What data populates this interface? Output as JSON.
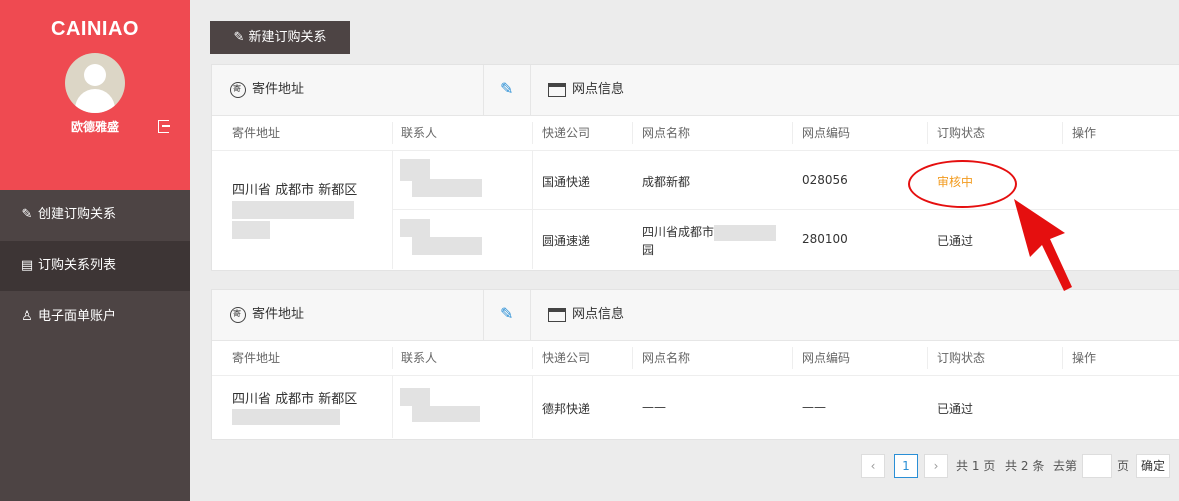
{
  "brand": {
    "logo": "CAINIAO",
    "username": "欧德雅盛"
  },
  "nav": [
    {
      "label": "创建订购关系",
      "icon": "edit-icon"
    },
    {
      "label": "订购关系列表",
      "icon": "list-icon"
    },
    {
      "label": "电子面单账户",
      "icon": "user-icon"
    }
  ],
  "toolbar": {
    "new_label": "新建订购关系"
  },
  "cards": [
    {
      "sender_title": "寄件地址",
      "branch_title": "网点信息",
      "headers": [
        "寄件地址",
        "联系人",
        "快递公司",
        "网点名称",
        "网点编码",
        "订购状态",
        "操作"
      ],
      "address": "四川省 成都市 新都区",
      "rows": [
        {
          "company": "国通快递",
          "branch_name": "成都新都",
          "branch_name_2": "",
          "code": "028056",
          "status": "审核中"
        },
        {
          "company": "圆通速递",
          "branch_name": "四川省成都市",
          "branch_name_2": "园",
          "code": "280100",
          "status": "已通过"
        }
      ]
    },
    {
      "sender_title": "寄件地址",
      "branch_title": "网点信息",
      "headers": [
        "寄件地址",
        "联系人",
        "快递公司",
        "网点名称",
        "网点编码",
        "订购状态",
        "操作"
      ],
      "address": "四川省 成都市 新都区",
      "rows": [
        {
          "company": "德邦快递",
          "branch_name": "——",
          "code": "——",
          "status": "已通过"
        }
      ]
    }
  ],
  "pagination": {
    "current": "1",
    "total_pages_prefix": "共",
    "total_pages": "1",
    "total_pages_suffix": "页",
    "total_items_prefix": "共",
    "total_items": "2",
    "total_items_suffix": "条",
    "goto_label": "去第",
    "goto_suffix": "页",
    "confirm": "确定"
  },
  "colors": {
    "brand_red": "#ef4a51",
    "sidebar": "#4d4444",
    "pending": "#f29b1f",
    "annotation": "#e50f0f"
  }
}
